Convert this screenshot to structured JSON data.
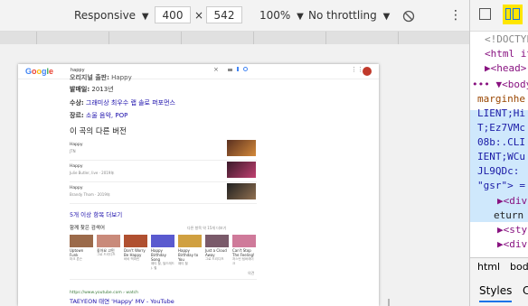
{
  "toolbar": {
    "device_label": "Responsive",
    "width_value": "400",
    "times": "×",
    "height_value": "542",
    "zoom_label": "100%",
    "throttle_label": "No throttling",
    "more_icon": "more-vert-icon",
    "rotate_icon": "rotate-icon"
  },
  "google": {
    "logo": "Google",
    "query": "happy",
    "close": "×",
    "info": [
      {
        "key": "오리지널 출판:",
        "value": "Happy",
        "link": false
      },
      {
        "key": "발매일:",
        "value": "2013년",
        "link": false
      },
      {
        "key": "수상:",
        "value": "그래미상 최우수 랩 솔로 퍼포먼스",
        "link": true
      },
      {
        "key": "장르:",
        "value": "소울 음악, POP",
        "link": false
      }
    ],
    "other_versions_title": "이 곡의 다른 버전",
    "versions": [
      {
        "title": "Happy",
        "artist": "JTN"
      },
      {
        "title": "Happy",
        "artist": "Julie Butler, live · 2019年"
      },
      {
        "title": "Happy",
        "artist": "Brandy Thom · 2019年"
      }
    ],
    "more_versions": "5개 이상 항목 더보기",
    "searched_title": "함께 찾은 검색어",
    "searched_more": "다른 항목 약 15개 더보기",
    "cards": [
      {
        "name": "Uptown Funk",
        "artist": "마크 론슨"
      },
      {
        "name": "좋아요 고민",
        "artist": "그로 드리디즈"
      },
      {
        "name": "Don't Worry Be Happy",
        "artist": "바비 맥퍼린"
      },
      {
        "name": "Happy Birthday Song",
        "artist": "패티 힐, 밀드레드 J. 힐"
      },
      {
        "name": "Happy Birthday to You",
        "artist": "패티 힐"
      },
      {
        "name": "Just a Cloud Away",
        "artist": "그로 드리디즈"
      },
      {
        "name": "Can't Stop The Feeling!",
        "artist": "저스틴 팀버레이크"
      }
    ],
    "feedback": "의견",
    "result_url": "https://www.youtube.com › watch",
    "result_title": "TAEYEON 태연 'Happy' MV - YouTube"
  },
  "devtools": {
    "lines": [
      "<!DOCTYPE",
      "<html it",
      "▶<head>",
      "••• ▼<body",
      "marginhe",
      "LIENT;Hi",
      "T;Ez7VMc",
      "08b:.CLI",
      "IENT;WCu",
      "JL9QDc:",
      "\"gsr\"> =",
      "▶<div",
      "eturn",
      "▶<sty",
      "▶<div"
    ],
    "tabs": [
      "html",
      "bod"
    ],
    "panel_tabs": [
      "Styles",
      "C"
    ]
  },
  "colors": {
    "devtools_highlight": "#cfe8fc",
    "device_toggle_bg": "#ffe600",
    "link_blue": "#1a0dab"
  }
}
